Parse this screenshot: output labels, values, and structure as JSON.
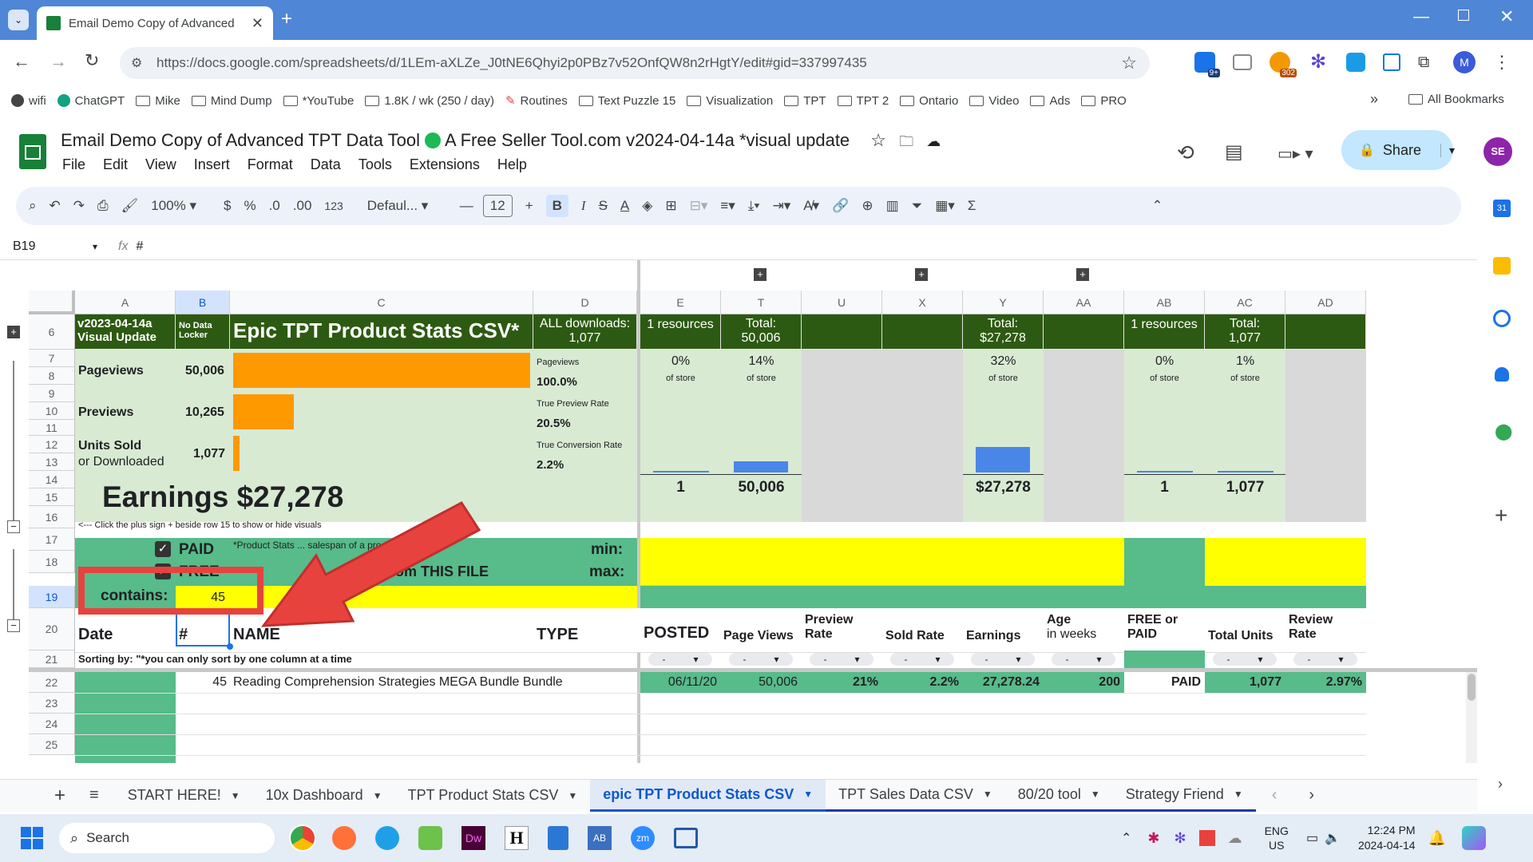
{
  "browser": {
    "tab_title": "Email Demo Copy of Advanced",
    "url": "https://docs.google.com/spreadsheets/d/1LEm-aXLZe_J0tNE6Qhyi2p0PBz7v52OnfQW8n2rHgtY/edit#gid=337997435",
    "ext_badge_1": "9+",
    "ext_badge_2": "302",
    "bookmarks": [
      "wifi",
      "ChatGPT",
      "Mike",
      "Mind Dump",
      "*YouTube",
      "1.8K / wk (250 / day)",
      "Routines",
      "Text Puzzle 15",
      "Visualization",
      "TPT",
      "TPT 2",
      "Ontario",
      "Video",
      "Ads",
      "PRO"
    ],
    "all_bookmarks": "All Bookmarks"
  },
  "sheets": {
    "doc_title_a": "Email Demo Copy of Advanced TPT Data Tool",
    "doc_title_b": "A Free Seller Tool.com v2024-04-14a *visual update",
    "menus": [
      "File",
      "Edit",
      "View",
      "Insert",
      "Format",
      "Data",
      "Tools",
      "Extensions",
      "Help"
    ],
    "share": "Share",
    "avatar": "SE OT",
    "zoom": "100%",
    "currency": "$",
    "percent": "%",
    "dec_less": ".0",
    "dec_more": ".00",
    "num_fmt": "123",
    "font": "Defaul...",
    "font_size": "12",
    "name_box": "B19",
    "formula": "#"
  },
  "columns": [
    "A",
    "B",
    "C",
    "D",
    "E",
    "T",
    "U",
    "X",
    "Y",
    "AA",
    "AB",
    "AC",
    "AD"
  ],
  "rows": [
    "6",
    "7",
    "8",
    "9",
    "10",
    "11",
    "12",
    "13",
    "14",
    "15",
    "16",
    "17",
    "18",
    "19",
    "20",
    "21",
    "22",
    "23",
    "24",
    "25"
  ],
  "cells": {
    "a6": "v2023-04-14a Visual Update",
    "b6": "No Data Locker",
    "c6": "Epic TPT Product Stats CSV*",
    "d6a": "ALL downloads:",
    "d6b": "1,077",
    "e6": "1 resources",
    "t6a": "Total:",
    "t6b": "50,006",
    "y6a": "Total:",
    "y6b": "$27,278",
    "ab6": "1 resources",
    "ac6a": "Total:",
    "ac6b": "1,077",
    "pageviews_label": "Pageviews",
    "pageviews_val": "50,006",
    "previews_label": "Previews",
    "previews_val": "10,265",
    "units_label_a": "Units Sold",
    "units_label_b": "or Downloaded",
    "units_val": "1,077",
    "d7a": "Pageviews",
    "d7b": "100.0%",
    "d9a": "True Preview Rate",
    "d9b": "20.5%",
    "d11a": "True Conversion Rate",
    "d11b": "2.2%",
    "e7a": "0%",
    "e7b": "of store",
    "t7a": "14%",
    "t7b": "of store",
    "y7a": "32%",
    "y7b": "of store",
    "ab7a": "0%",
    "ab7b": "of store",
    "ac7a": "1%",
    "ac7b": "of store",
    "e13": "1",
    "t13": "50,006",
    "y13": "$27,278",
    "ab13": "1",
    "ac13": "1,077",
    "earnings": "Earnings $27,278",
    "a15": "<--- Click the plus sign + beside row 15 to show or hide visuals",
    "paid": "PAID",
    "free": "FREE",
    "c16": "*Product Stats ... salespan of a product",
    "c17": "... data from THIS FILE",
    "min": "min:",
    "max": "max:",
    "contains": "contains:",
    "contains_val": "45",
    "h_date": "Date",
    "h_num": "#",
    "h_name": "NAME",
    "h_type": "TYPE",
    "h_posted": "POSTED",
    "h_pageviews": "Page Views",
    "h_preview_a": "Preview",
    "h_preview_b": "Rate",
    "h_sold": "Sold Rate",
    "h_earn": "Earnings",
    "h_age_a": "Age",
    "h_age_b": "in weeks",
    "h_free_a": "FREE or",
    "h_free_b": "PAID",
    "h_units": "Total Units",
    "h_review_a": "Review",
    "h_review_b": "Rate",
    "sort_note": "Sorting by:  \"*you can only sort by one column at a time",
    "dash": "-",
    "r21_num": "45",
    "r21_name": "Reading Comprehension Strategies MEGA Bundle Bundle",
    "r21_posted": "06/11/20",
    "r21_pv": "50,006",
    "r21_prev": "21%",
    "r21_sold": "2.2%",
    "r21_earn": "27,278.24",
    "r21_age": "200",
    "r21_paid": "PAID",
    "r21_units": "1,077",
    "r21_review": "2.97%"
  },
  "bars": {
    "pageviews": 1.0,
    "previews": 0.205,
    "units": 0.022,
    "chart_t": 0.14,
    "chart_y": 0.32,
    "chart_ac": 0.01
  },
  "sheet_tabs": [
    "START HERE!",
    "10x Dashboard",
    "TPT Product Stats CSV",
    "epic TPT Product Stats CSV",
    "TPT Sales Data CSV",
    "80/20 tool",
    "Strategy Friend"
  ],
  "taskbar": {
    "search": "Search",
    "lang_a": "ENG",
    "lang_b": "US",
    "time": "12:24 PM",
    "date": "2024-04-14"
  },
  "colors": {
    "accent": "#0b57d0",
    "dark_green": "#2d5a12",
    "light_green": "#d9ead3",
    "mid_green": "#57bb8a",
    "yellow": "#ffff00",
    "orange": "#ff9900",
    "annotation_red": "#e8423f"
  }
}
